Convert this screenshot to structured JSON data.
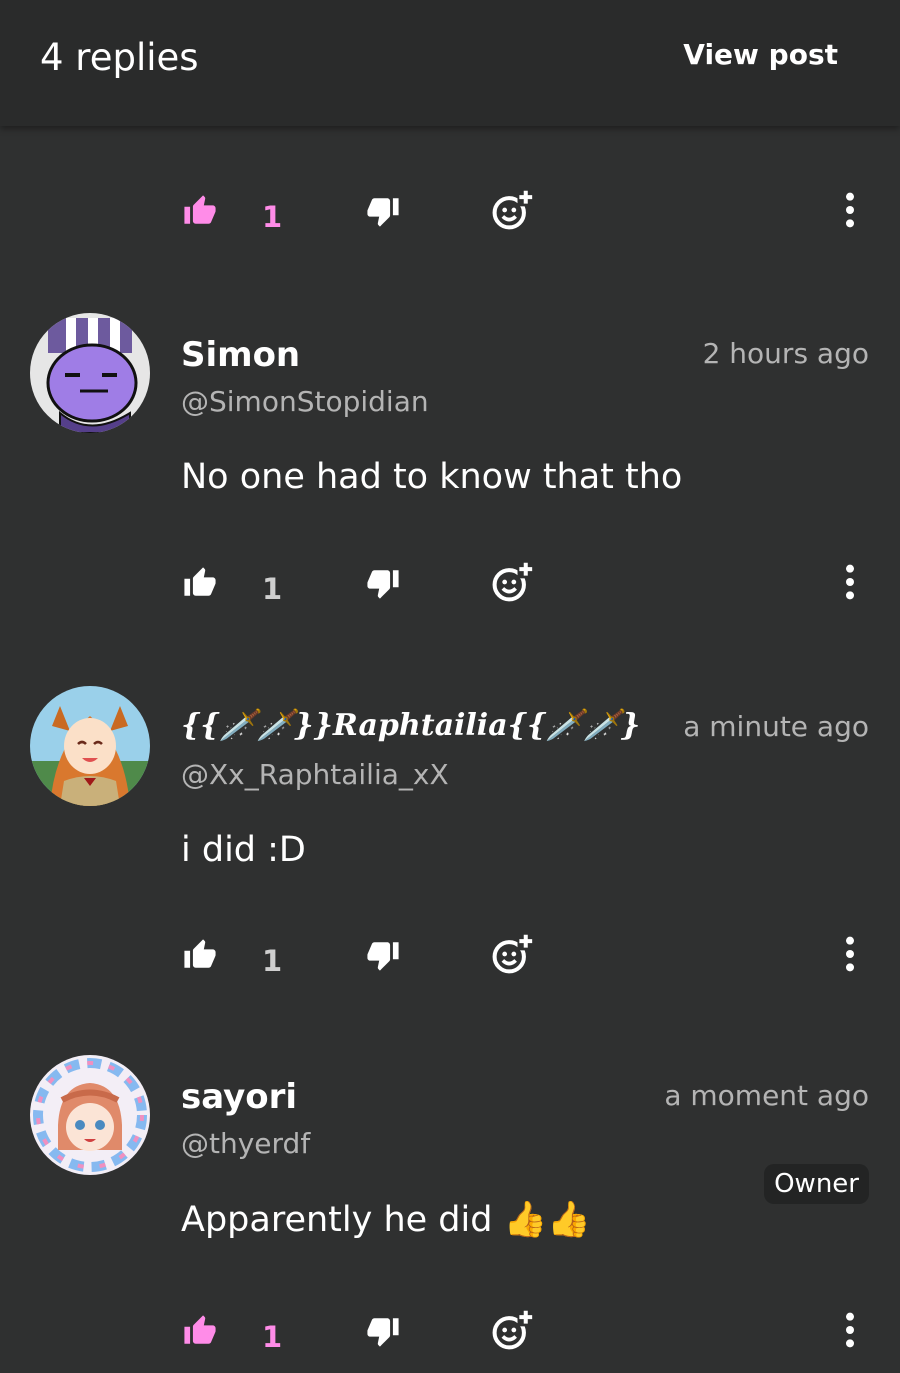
{
  "header": {
    "title": "4 replies",
    "view_post_label": "View post"
  },
  "colors": {
    "background": "#2f3030",
    "header": "#2a2b2b",
    "accent_pink": "#ff8ce8",
    "muted_text": "#b4b4b4"
  },
  "first_actions": {
    "like_count": "1",
    "liked": true
  },
  "comments": [
    {
      "name": "Simon",
      "handle": "@SimonStopidian",
      "time": "2 hours ago",
      "text": "No one had to know that tho",
      "like_count": "1",
      "liked": false
    },
    {
      "name": "{{🗡️🗡️}}Raphtailia{{🗡️🗡️}",
      "handle": "@Xx_Raphtailia_xX",
      "time": "a minute ago",
      "text": "i did :D",
      "like_count": "1",
      "liked": false
    },
    {
      "name": "sayori",
      "handle": "@thyerdf",
      "time": "a moment ago",
      "badge": "Owner",
      "text": "Apparently he did 👍👍",
      "like_count": "1",
      "liked": true
    }
  ],
  "icons": [
    "thumbs-up-icon",
    "thumbs-down-icon",
    "add-reaction-icon",
    "more-vertical-icon"
  ]
}
